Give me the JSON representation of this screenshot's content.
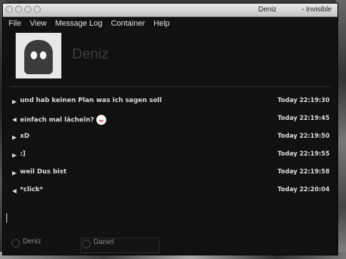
{
  "window": {
    "title": "Deniz",
    "status": "- Invisible"
  },
  "menu": [
    "File",
    "View",
    "Message Log",
    "Container",
    "Help"
  ],
  "contact": {
    "name": "Deniz"
  },
  "messages": [
    {
      "direction": "in",
      "text": "und hab keinen Plan was ich sagen soll",
      "time": "Today 22:19:30",
      "smiley": false
    },
    {
      "direction": "out",
      "text": "einfach mal lächeln?",
      "time": "Today 22:19:45",
      "smiley": true
    },
    {
      "direction": "in",
      "text": "xD",
      "time": "Today 22:19:50",
      "smiley": false
    },
    {
      "direction": "in",
      "text": ":]",
      "time": "Today 22:19:55",
      "smiley": false
    },
    {
      "direction": "in",
      "text": "weil Dus bist",
      "time": "Today 22:19:58",
      "smiley": false
    },
    {
      "direction": "out",
      "text": "*click*",
      "time": "Today 22:20:04",
      "smiley": false
    }
  ],
  "tabs": [
    {
      "label": "Deniz"
    },
    {
      "label": "Daniel"
    }
  ]
}
